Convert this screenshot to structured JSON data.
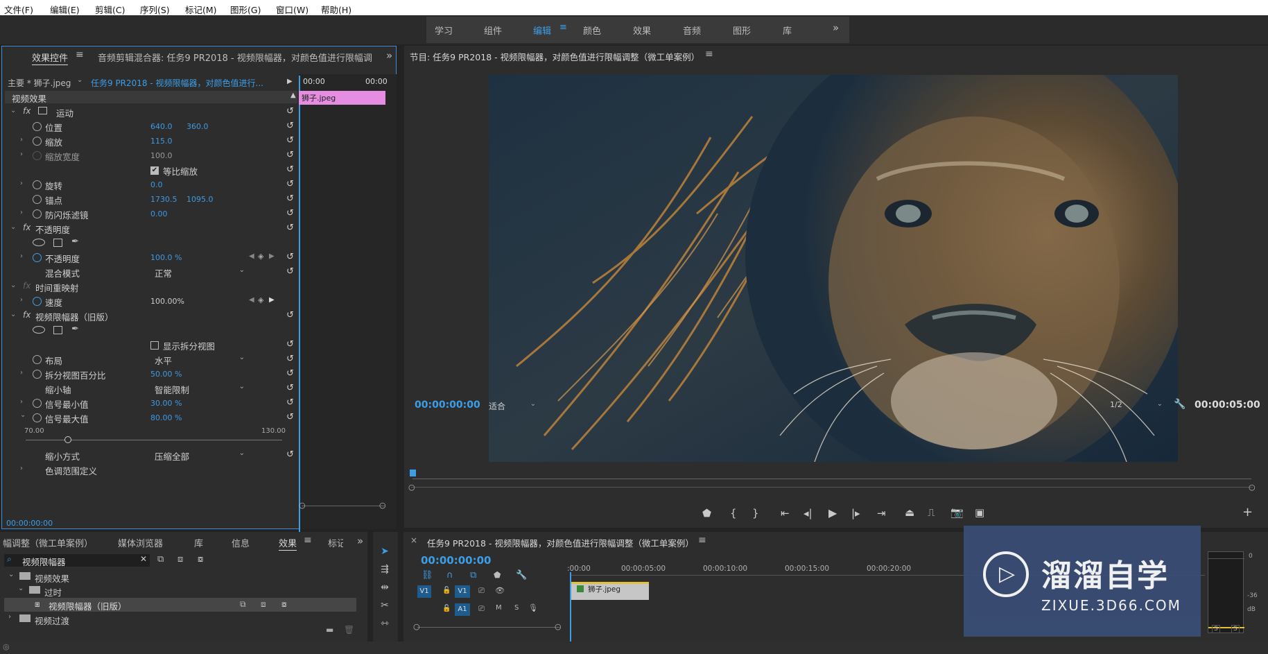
{
  "menu": [
    "文件(F)",
    "编辑(E)",
    "剪辑(C)",
    "序列(S)",
    "标记(M)",
    "图形(G)",
    "窗口(W)",
    "帮助(H)"
  ],
  "workspaces": [
    "学习",
    "组件",
    "编辑",
    "颜色",
    "效果",
    "音频",
    "图形",
    "库"
  ],
  "workspace_active": "编辑",
  "effect_controls": {
    "tab_effects": "效果控件",
    "tab_mixer": "音频剪辑混合器: 任务9 PR2018 - 视频限幅器，对颜色值进行限幅调",
    "master_label": "主要 * 狮子.jpeg",
    "sequence_label": "任务9 PR2018 - 视频限幅器，对颜色值进行...",
    "tc_start": "00:00",
    "tc_end": "00:00",
    "clip_name": "狮子.jpeg",
    "section_video": "视频效果",
    "motion": "运动",
    "position": "位置",
    "position_x": "640.0",
    "position_y": "360.0",
    "scale": "缩放",
    "scale_val": "115.0",
    "scale_width": "缩放宽度",
    "scale_width_val": "100.0",
    "uniform_scale": "等比缩放",
    "rotation": "旋转",
    "rotation_val": "0.0",
    "anchor": "锚点",
    "anchor_x": "1730.5",
    "anchor_y": "1095.0",
    "antiflicker": "防闪烁滤镜",
    "antiflicker_val": "0.00",
    "opacity_group": "不透明度",
    "opacity": "不透明度",
    "opacity_val": "100.0 %",
    "blend_mode": "混合模式",
    "blend_val": "正常",
    "time_remap": "时间重映射",
    "speed": "速度",
    "speed_val": "100.00%",
    "limiter": "视频限幅器（旧版）",
    "show_split": "显示拆分视图",
    "layout": "布局",
    "layout_val": "水平",
    "split_pct": "拆分视图百分比",
    "split_pct_val": "50.00 %",
    "reduce_axis": "缩小轴",
    "reduce_axis_val": "智能限制",
    "signal_min": "信号最小值",
    "signal_min_val": "30.00 %",
    "signal_max": "信号最大值",
    "signal_max_val": "80.00 %",
    "slider_min": "70.00",
    "slider_max": "130.00",
    "reduce_method": "缩小方式",
    "reduce_method_val": "压缩全部",
    "tonal_range": "色调范围定义",
    "footer_tc": "00:00:00:00"
  },
  "program": {
    "title": "节目: 任务9 PR2018 - 视频限幅器，对颜色值进行限幅调整（微工单案例）",
    "tc_left": "00:00:00:00",
    "fit": "适合",
    "res": "1/2",
    "tc_right": "00:00:05:00"
  },
  "project": {
    "tabs": [
      "幅调整（微工单案例）",
      "媒体浏览器",
      "库",
      "信息",
      "效果",
      "标记"
    ],
    "search_value": "视频限幅器",
    "tree": [
      "视频效果",
      "过时",
      "视频限幅器（旧版）",
      "视频过渡"
    ]
  },
  "timeline": {
    "title": "任务9 PR2018 - 视频限幅器，对颜色值进行限幅调整（微工单案例）",
    "tc": "00:00:00:00",
    "ticks": [
      ":00:00",
      "00:00:05:00",
      "00:00:10:00",
      "00:00:15:00",
      "00:00:20:00"
    ],
    "v1": "V1",
    "a1": "A1",
    "m": "M",
    "s": "S",
    "clip": "狮子.jpeg"
  },
  "watermark": {
    "title": "溜溜自学",
    "url": "ZIXUE.3D66.COM"
  },
  "meter": {
    "zero": "0",
    "minus36": "-36",
    "db": "dB",
    "s": "S"
  },
  "colors": {
    "accent": "#3d9ee8",
    "clip_pink": "#e58de0",
    "panel": "#2d2d2d"
  }
}
